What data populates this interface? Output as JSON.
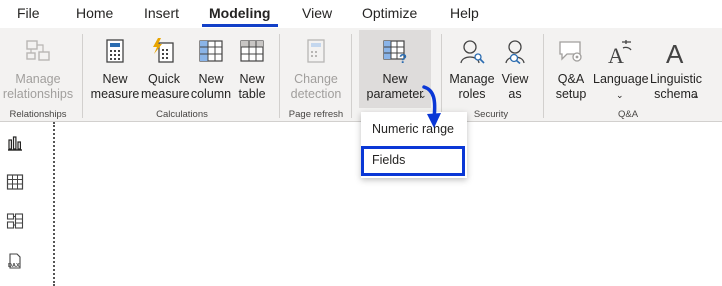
{
  "menu": {
    "file": "File",
    "home": "Home",
    "insert": "Insert",
    "modeling": "Modeling",
    "view": "View",
    "optimize": "Optimize",
    "help": "Help"
  },
  "ribbon": {
    "manage_relationships": "Manage\nrelationships",
    "new_measure": "New\nmeasure",
    "quick_measure": "Quick\nmeasure",
    "new_column": "New\ncolumn",
    "new_table": "New\ntable",
    "change_detection": "Change\ndetection",
    "new_parameter": "New\nparameter",
    "manage_roles": "Manage\nroles",
    "view_as": "View\nas",
    "qa_setup": "Q&A\nsetup",
    "language": "Language",
    "linguistic_schema": "Linguistic\nschema"
  },
  "groups": {
    "relationships": "Relationships",
    "calculations": "Calculations",
    "page_refresh": "Page refresh",
    "security": "Security",
    "qa": "Q&A"
  },
  "dropdown": {
    "numeric_range": "Numeric range",
    "fields": "Fields"
  },
  "colors": {
    "accent": "#1340c8",
    "highlight_border": "#0a37d6",
    "ribbon_bg": "#f3f2f1",
    "icon_blue": "#2b6cb0",
    "lightning": "#e8a500"
  }
}
